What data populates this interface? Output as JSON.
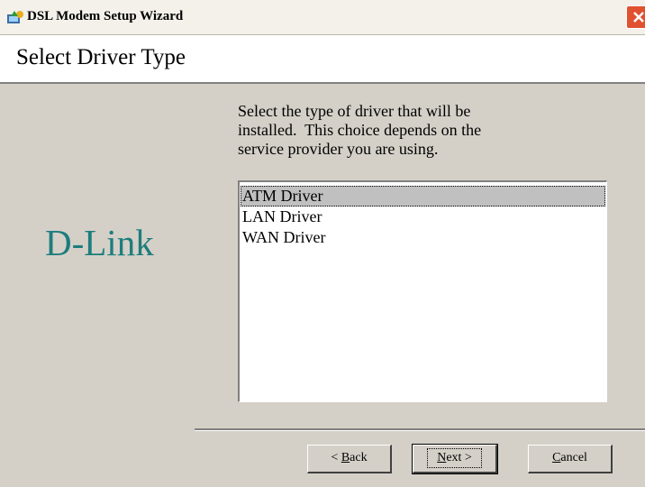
{
  "window": {
    "title": "DSL Modem Setup Wizard"
  },
  "header": {
    "title": "Select Driver Type"
  },
  "logo": {
    "text": "D-Link"
  },
  "description": {
    "line1": "Select the type of driver that will be",
    "line2": "installed.  This choice depends on the",
    "line3": "service provider you are using."
  },
  "drivers": {
    "selected": "ATM Driver",
    "items": [
      "ATM Driver",
      "LAN Driver",
      "WAN Driver"
    ]
  },
  "buttons": {
    "back_prefix": "< ",
    "back_mnemonic": "B",
    "back_rest": "ack",
    "next_mnemonic": "N",
    "next_rest": "ext >",
    "cancel_mnemonic": "C",
    "cancel_rest": "ancel"
  },
  "colors": {
    "logo": "#1e7d7d",
    "close_button": "#e0512f"
  }
}
